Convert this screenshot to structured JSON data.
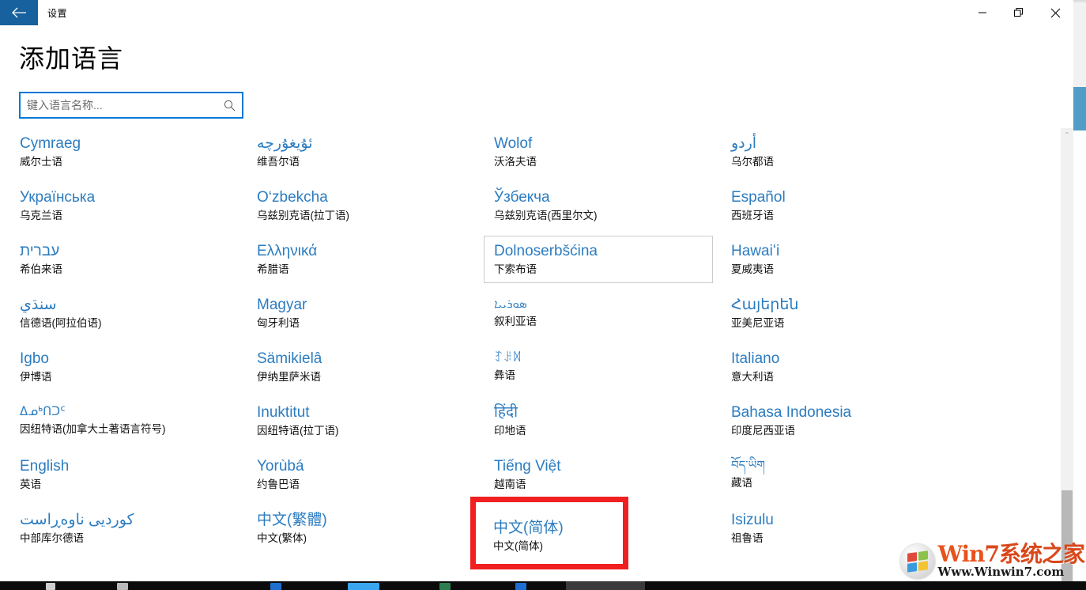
{
  "window": {
    "app_title": "设置",
    "back_icon": "back-arrow-icon",
    "controls": {
      "minimize_label": "—",
      "restore_label": "❐",
      "close_label": "✕"
    }
  },
  "page": {
    "heading": "添加语言"
  },
  "search": {
    "placeholder": "键入语言名称...",
    "value": "",
    "icon": "search-icon"
  },
  "colors": {
    "accent": "#0078d7",
    "title_bar_back": "#16619e",
    "language_link": "#2b7cc0",
    "annotation": "#f02020",
    "scroll_thumb": "#b8b8b8"
  },
  "languages": [
    {
      "native": "Cymraeg",
      "local": "威尔士语",
      "rtl": false,
      "small": false,
      "hovered": false
    },
    {
      "native": "ئۇيغۇرچە",
      "local": "维吾尔语",
      "rtl": true,
      "small": false,
      "hovered": false
    },
    {
      "native": "Wolof",
      "local": "沃洛夫语",
      "rtl": false,
      "small": false,
      "hovered": false
    },
    {
      "native": "أردو",
      "local": "乌尔都语",
      "rtl": true,
      "small": false,
      "hovered": false
    },
    {
      "native": "Українська",
      "local": "乌克兰语",
      "rtl": false,
      "small": false,
      "hovered": false
    },
    {
      "native": "O‘zbekcha",
      "local": "乌兹别克语(拉丁语)",
      "rtl": false,
      "small": false,
      "hovered": false
    },
    {
      "native": "Ўзбекча",
      "local": "乌兹别克语(西里尔文)",
      "rtl": false,
      "small": false,
      "hovered": false
    },
    {
      "native": "Español",
      "local": "西班牙语",
      "rtl": false,
      "small": false,
      "hovered": false
    },
    {
      "native": "עברית",
      "local": "希伯来语",
      "rtl": true,
      "small": false,
      "hovered": false
    },
    {
      "native": "Ελληνικά",
      "local": "希腊语",
      "rtl": false,
      "small": false,
      "hovered": false
    },
    {
      "native": "Dolnoserbšćina",
      "local": "下索布语",
      "rtl": false,
      "small": false,
      "hovered": true
    },
    {
      "native": "Hawaiʻi",
      "local": "夏威夷语",
      "rtl": false,
      "small": false,
      "hovered": false
    },
    {
      "native": "سنڌي",
      "local": "信德语(阿拉伯语)",
      "rtl": true,
      "small": false,
      "hovered": false
    },
    {
      "native": "Magyar",
      "local": "匈牙利语",
      "rtl": false,
      "small": false,
      "hovered": false
    },
    {
      "native": "ܣܘܪܝܝܐ",
      "local": "叙利亚语",
      "rtl": true,
      "small": true,
      "hovered": false
    },
    {
      "native": "Հայերեն",
      "local": "亚美尼亚语",
      "rtl": false,
      "small": false,
      "hovered": false
    },
    {
      "native": "Igbo",
      "local": "伊博语",
      "rtl": false,
      "small": false,
      "hovered": false
    },
    {
      "native": "Sämikielâ",
      "local": "伊纳里萨米语",
      "rtl": false,
      "small": false,
      "hovered": false
    },
    {
      "native": "ꆈꌠꉙ",
      "local": "彝语",
      "rtl": false,
      "small": true,
      "hovered": false
    },
    {
      "native": "Italiano",
      "local": "意大利语",
      "rtl": false,
      "small": false,
      "hovered": false
    },
    {
      "native": "ᐃᓄᒃᑎᑐᑦ",
      "local": "因纽特语(加拿大土著语言符号)",
      "rtl": false,
      "small": true,
      "hovered": false
    },
    {
      "native": "Inuktitut",
      "local": "因纽特语(拉丁语)",
      "rtl": false,
      "small": false,
      "hovered": false
    },
    {
      "native": "हिंदी",
      "local": "印地语",
      "rtl": false,
      "small": false,
      "hovered": false
    },
    {
      "native": "Bahasa Indonesia",
      "local": "印度尼西亚语",
      "rtl": false,
      "small": false,
      "hovered": false
    },
    {
      "native": "English",
      "local": "英语",
      "rtl": false,
      "small": false,
      "hovered": false
    },
    {
      "native": "Yorùbá",
      "local": "约鲁巴语",
      "rtl": false,
      "small": false,
      "hovered": false
    },
    {
      "native": "Tiếng Việt",
      "local": "越南语",
      "rtl": false,
      "small": false,
      "hovered": false
    },
    {
      "native": "བོད་ཡིག",
      "local": "藏语",
      "rtl": false,
      "small": true,
      "hovered": false
    },
    {
      "native": "کوردیی ناوەڕاست",
      "local": "中部库尔德语",
      "rtl": true,
      "small": false,
      "hovered": false
    },
    {
      "native": "中文(繁體)",
      "local": "中文(繁体)",
      "rtl": false,
      "small": false,
      "hovered": false
    },
    {
      "native": "中文(简体)",
      "local": "中文(简体)",
      "rtl": false,
      "small": false,
      "hovered": false
    },
    {
      "native": "Isizulu",
      "local": "祖鲁语",
      "rtl": false,
      "small": false,
      "hovered": false
    }
  ],
  "annotation": {
    "target_native": "中文(简体)",
    "target_local": "中文(简体)"
  },
  "watermark": {
    "line1_pre": "Win",
    "line1_num": "7",
    "line1_post": "系统之家",
    "line2": "Www.Winwin7.com"
  },
  "scrollbar": {
    "up_arrow": "⌃"
  }
}
